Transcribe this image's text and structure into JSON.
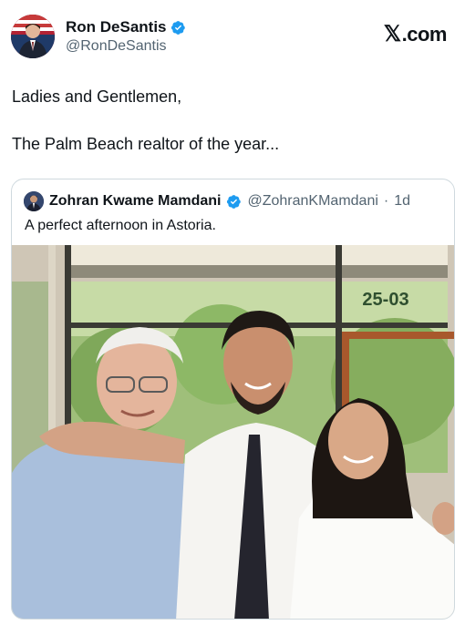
{
  "brand": {
    "logo_x": "𝕏",
    "logo_text": ".com"
  },
  "post": {
    "author_name": "Ron DeSantis",
    "author_handle": "@RonDeSantis",
    "line1": "Ladies and Gentlemen,",
    "line2": "The Palm Beach realtor of the year..."
  },
  "quote": {
    "author_name": "Zohran Kwame Mamdani",
    "author_handle": "@ZohranKMamdani",
    "separator": "·",
    "age": "1d",
    "text": "A perfect afternoon in Astoria.",
    "sign_text": "25-03"
  },
  "colors": {
    "verified": "#1d9bf0",
    "secondary_text": "#536471",
    "border": "#cfd9de"
  },
  "icons": {
    "verified": "verified-badge-icon"
  }
}
